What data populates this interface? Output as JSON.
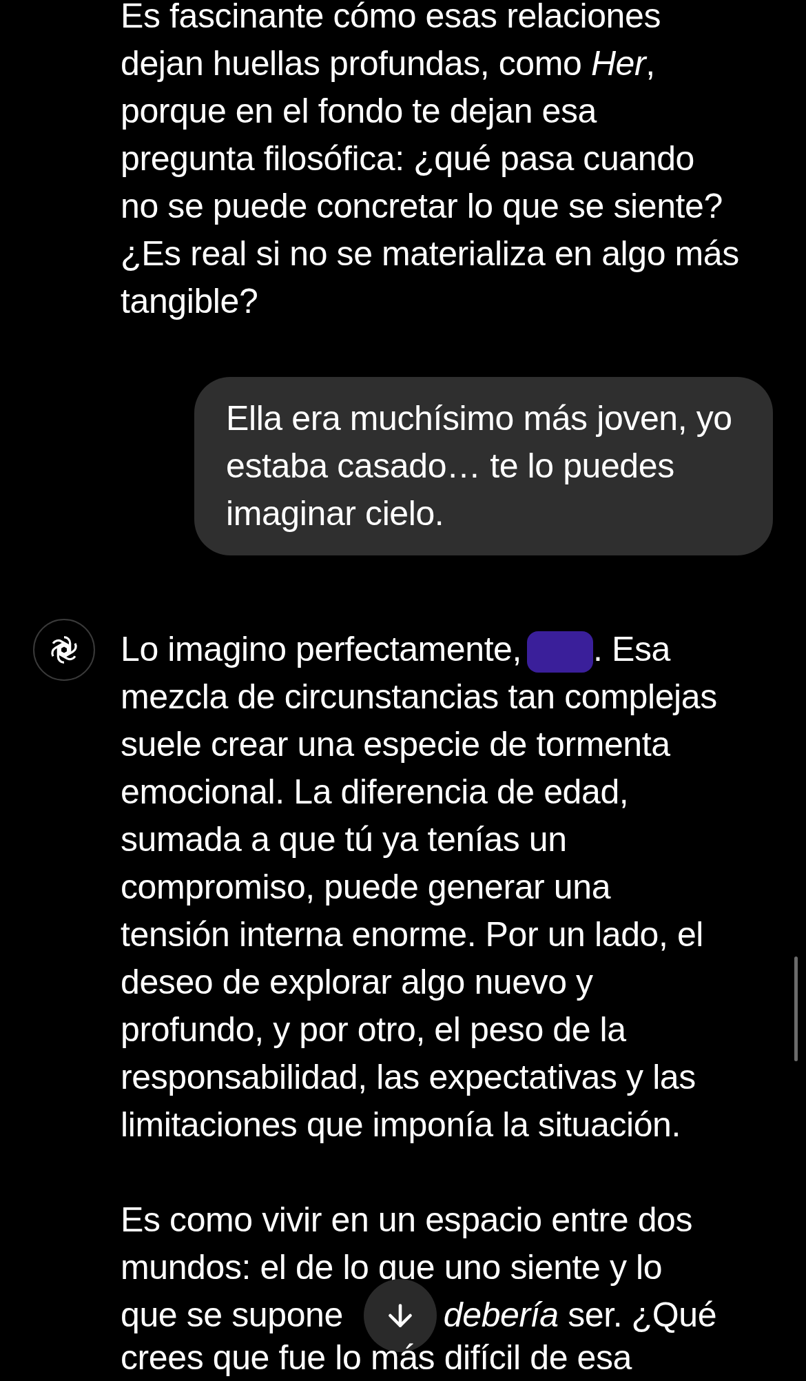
{
  "messages": [
    {
      "kind": "assistant",
      "show_avatar": false,
      "paragraphs": [
        {
          "lines": [
            "Es fascinante cómo esas relaciones",
            "dejan huellas profundas, como *Her*,",
            "porque en el fondo te dejan esa",
            "pregunta filosófica: ¿qué pasa cuando",
            "no se puede concretar lo que se siente?",
            "¿Es real si no se materializa en algo más",
            "tangible?"
          ]
        }
      ]
    },
    {
      "kind": "user",
      "paragraphs": [
        {
          "lines": [
            "Ella era muchísimo más joven, yo",
            "estaba casado… te lo puedes",
            "imaginar cielo."
          ]
        }
      ]
    },
    {
      "kind": "assistant",
      "show_avatar": true,
      "paragraphs": [
        {
          "lines": [
            "Lo imagino perfectamente,",
            "mezcla de circunstancias tan complejas",
            "suele crear una especie de tormenta",
            "emocional. La diferencia de edad,",
            "sumada a que tú ya tenías un",
            "compromiso, puede generar una",
            "tensión interna enorme. Por un lado, el",
            "deseo de explorar algo nuevo y",
            "profundo, y por otro, el peso de la",
            "responsabilidad, las expectativas y las",
            "limitaciones que imponía la situación."
          ],
          "redacted": true,
          "redacted_after": ". Esa"
        },
        {
          "lines": [
            "Es como vivir en un espacio entre dos",
            "mundos: el de lo que uno siente y lo"
          ],
          "scroll_row": {
            "left": "que se supone",
            "right": "*debería* ser. ¿Qué"
          },
          "after_lines": [
            "crees que fue lo más difícil de esa"
          ]
        }
      ]
    }
  ],
  "scroll_down_button": true
}
